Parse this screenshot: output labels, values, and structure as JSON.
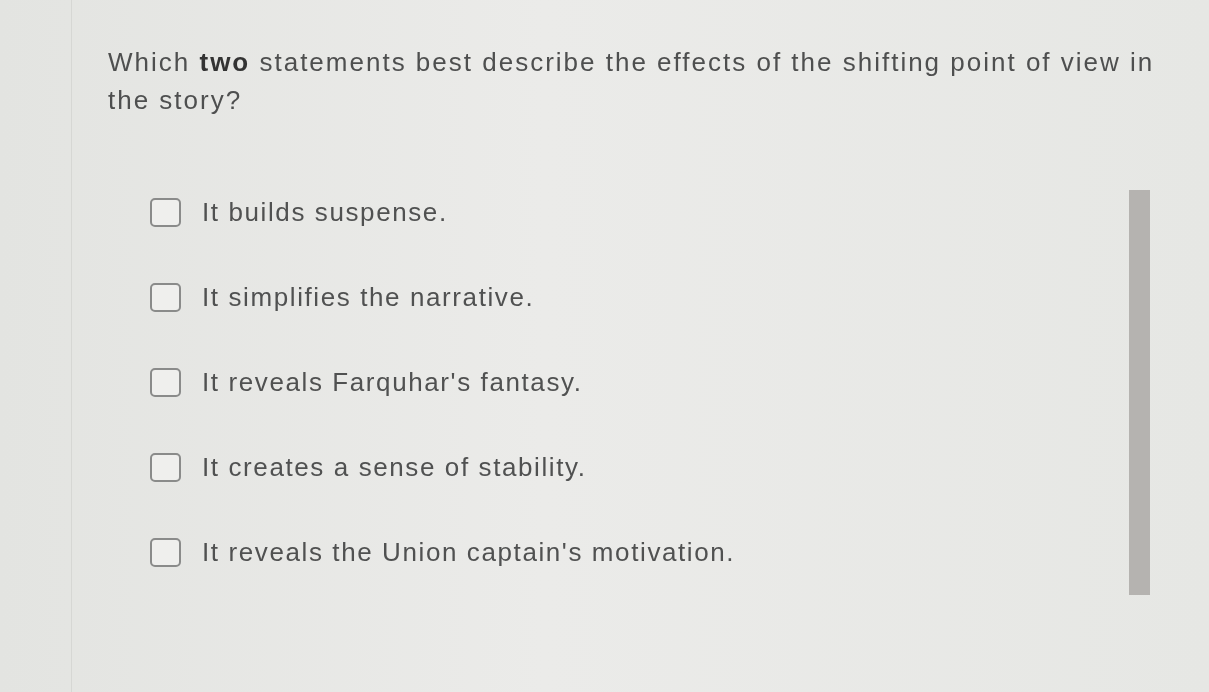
{
  "question": {
    "text": "Which **two** statements best describe the effects of the shifting point of view in the story?"
  },
  "options": [
    {
      "label": "It builds suspense.",
      "checked": false
    },
    {
      "label": "It simplifies the narrative.",
      "checked": false
    },
    {
      "label": "It reveals Farquhar's fantasy.",
      "checked": false
    },
    {
      "label": "It creates a sense of stability.",
      "checked": false
    },
    {
      "label": "It reveals the Union captain's motivation.",
      "checked": false
    }
  ]
}
